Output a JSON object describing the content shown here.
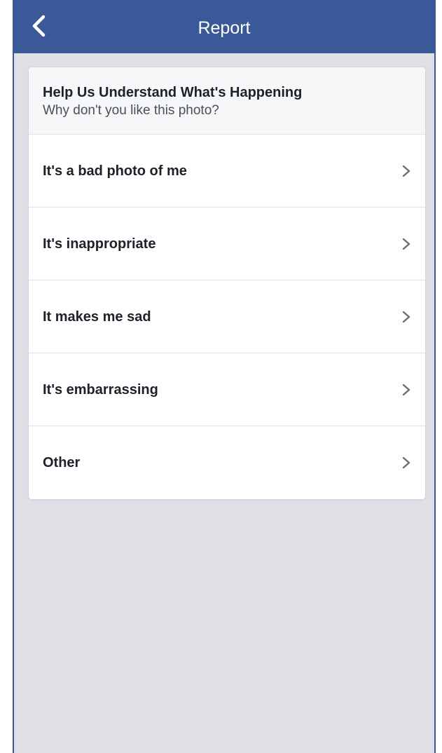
{
  "navbar": {
    "title": "Report",
    "back_icon": "chevron-left-icon",
    "background": "#3b5998"
  },
  "card": {
    "title": "Help Us Understand What's Happening",
    "subtitle": "Why don't you like this photo?"
  },
  "options": [
    {
      "label": "It's a bad photo of me",
      "icon": "chevron-right-icon"
    },
    {
      "label": "It's inappropriate",
      "icon": "chevron-right-icon"
    },
    {
      "label": "It makes me sad",
      "icon": "chevron-right-icon"
    },
    {
      "label": "It's embarrassing",
      "icon": "chevron-right-icon"
    },
    {
      "label": "Other",
      "icon": "chevron-right-icon"
    }
  ]
}
